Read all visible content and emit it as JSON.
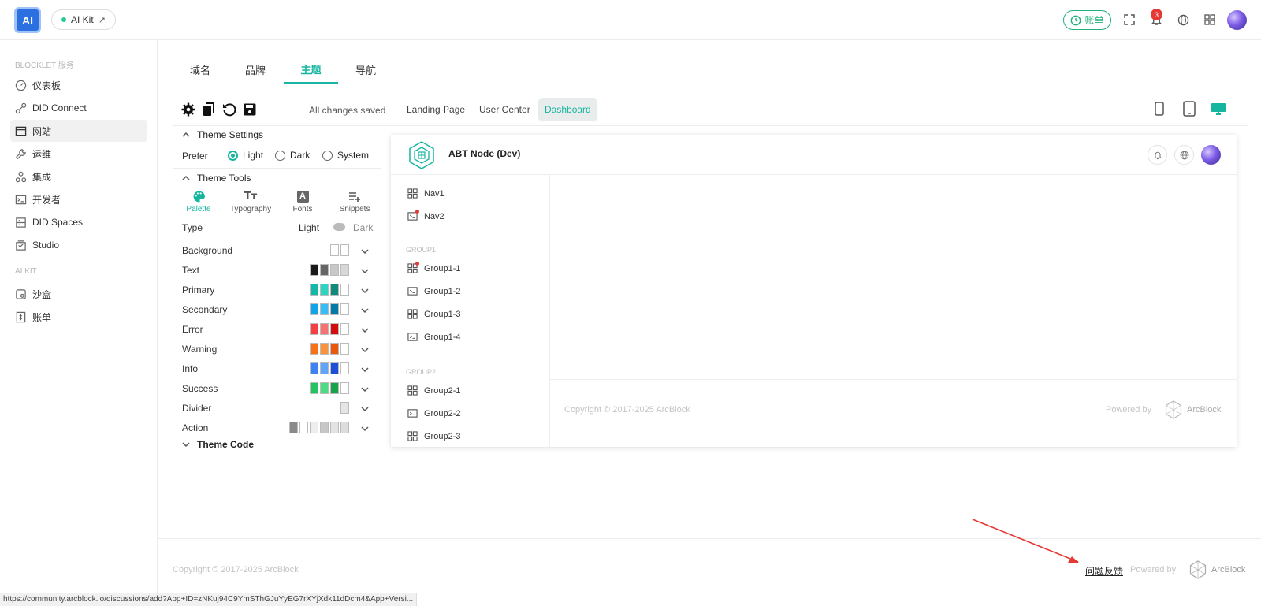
{
  "header": {
    "logo_text": "AI",
    "kit_label": "AI Kit",
    "kit_arrow": "↗",
    "bill_label": "账单",
    "notification_count": "3"
  },
  "sidebar": {
    "groups": [
      {
        "title": "BLOCKLET 服务",
        "items": [
          {
            "label": "仪表板",
            "icon": "dashboard-icon"
          },
          {
            "label": "DID Connect",
            "icon": "connect-icon"
          },
          {
            "label": "网站",
            "icon": "website-icon",
            "active": true
          },
          {
            "label": "运维",
            "icon": "wrench-icon"
          },
          {
            "label": "集成",
            "icon": "integration-icon"
          },
          {
            "label": "开发者",
            "icon": "terminal-icon"
          },
          {
            "label": "DID Spaces",
            "icon": "storage-icon"
          },
          {
            "label": "Studio",
            "icon": "studio-icon"
          }
        ]
      },
      {
        "title": "AI KIT",
        "items": [
          {
            "label": "沙盒",
            "icon": "sandbox-icon"
          },
          {
            "label": "账单",
            "icon": "bill-icon"
          }
        ]
      }
    ]
  },
  "tabs": [
    {
      "label": "域名"
    },
    {
      "label": "品牌"
    },
    {
      "label": "主题",
      "active": true
    },
    {
      "label": "导航"
    }
  ],
  "editor": {
    "status": "All changes saved",
    "theme_settings_label": "Theme Settings",
    "prefer_label": "Prefer",
    "prefer_options": [
      "Light",
      "Dark",
      "System"
    ],
    "prefer_selected": "Light",
    "theme_tools_label": "Theme Tools",
    "tool_tabs": [
      {
        "label": "Palette",
        "icon": "palette-icon",
        "active": true
      },
      {
        "label": "Typography",
        "icon": "typography-icon"
      },
      {
        "label": "Fonts",
        "icon": "font-icon"
      },
      {
        "label": "Snippets",
        "icon": "snippets-icon"
      }
    ],
    "type_label": "Type",
    "type_light": "Light",
    "type_dark": "Dark",
    "palette": [
      {
        "label": "Background",
        "colors": [
          "#ffffff",
          "#ffffff"
        ]
      },
      {
        "label": "Text",
        "colors": [
          "#1a1a1a",
          "#666666",
          "#c8c8c8",
          "#d7d7d7"
        ]
      },
      {
        "label": "Primary",
        "colors": [
          "#14b8a6",
          "#2dd4bf",
          "#0f8a7c",
          "#ffffff"
        ]
      },
      {
        "label": "Secondary",
        "colors": [
          "#0ea5e9",
          "#38bdf8",
          "#0379a8",
          "#ffffff"
        ]
      },
      {
        "label": "Error",
        "colors": [
          "#f43f45",
          "#f87171",
          "#d10c0c",
          "#ffffff"
        ]
      },
      {
        "label": "Warning",
        "colors": [
          "#f97316",
          "#fb923c",
          "#ea580c",
          "#ffffff"
        ]
      },
      {
        "label": "Info",
        "colors": [
          "#3b82f6",
          "#60a5fa",
          "#1d4ed8",
          "#ffffff"
        ]
      },
      {
        "label": "Success",
        "colors": [
          "#22c55e",
          "#4ade80",
          "#16a34a",
          "#ffffff"
        ]
      },
      {
        "label": "Divider",
        "colors": [
          "#e5e5e5"
        ]
      },
      {
        "label": "Action",
        "colors": [
          "#8a8a8a",
          "#ffffff",
          "#eeeeee",
          "#c7c7c7",
          "#e3e3e3",
          "#dddddd"
        ]
      }
    ],
    "theme_code_label": "Theme Code"
  },
  "preview_tabs": [
    {
      "label": "Landing Page"
    },
    {
      "label": "User Center"
    },
    {
      "label": "Dashboard",
      "active": true
    }
  ],
  "preview": {
    "app_name": "ABT Node (Dev)",
    "nav": [
      {
        "label": "Nav1",
        "icon": "grid-icon"
      },
      {
        "label": "Nav2",
        "icon": "terminal-icon",
        "dot": true
      }
    ],
    "groups": [
      {
        "title": "GROUP1",
        "items": [
          {
            "label": "Group1-1",
            "icon": "grid-icon",
            "dot": true
          },
          {
            "label": "Group1-2",
            "icon": "terminal-icon"
          },
          {
            "label": "Group1-3",
            "icon": "grid-icon"
          },
          {
            "label": "Group1-4",
            "icon": "terminal-icon"
          }
        ]
      },
      {
        "title": "GROUP2",
        "items": [
          {
            "label": "Group2-1",
            "icon": "grid-icon"
          },
          {
            "label": "Group2-2",
            "icon": "terminal-icon"
          },
          {
            "label": "Group2-3",
            "icon": "grid-icon"
          }
        ]
      }
    ],
    "copyright": "Copyright © 2017-2025  ArcBlock",
    "powered_by": "Powered by",
    "brand": "ArcBlock"
  },
  "footer": {
    "copyright": "Copyright © 2017-2025  ArcBlock",
    "feedback": "问题反馈",
    "powered_by": "Powered by",
    "brand": "ArcBlock"
  },
  "status_bar_url": "https://community.arcblock.io/discussions/add?App+ID=zNKuj94C9YmSThGJuYyEG7rXYjXdk11dDcm4&App+Versi..."
}
